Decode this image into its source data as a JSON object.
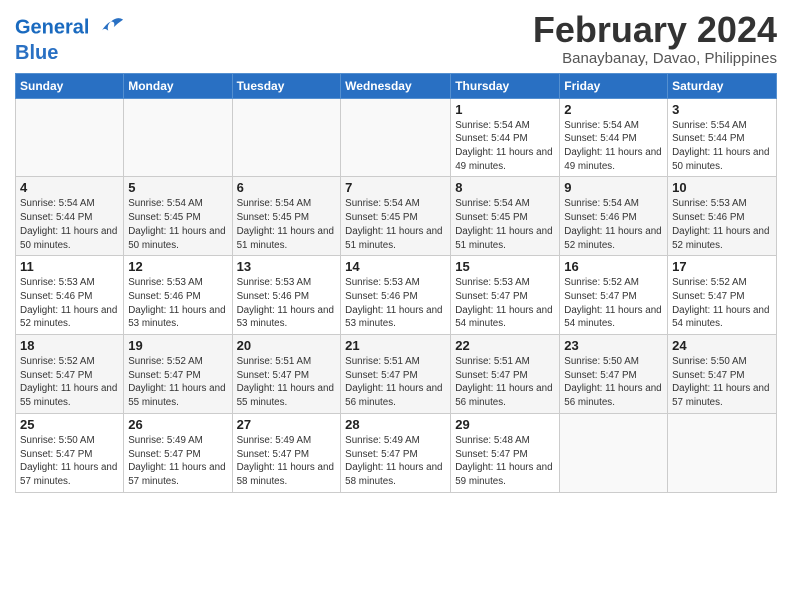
{
  "header": {
    "logo_line1": "General",
    "logo_line2": "Blue",
    "month": "February 2024",
    "location": "Banaybanay, Davao, Philippines"
  },
  "days_of_week": [
    "Sunday",
    "Monday",
    "Tuesday",
    "Wednesday",
    "Thursday",
    "Friday",
    "Saturday"
  ],
  "weeks": [
    [
      {
        "day": "",
        "info": ""
      },
      {
        "day": "",
        "info": ""
      },
      {
        "day": "",
        "info": ""
      },
      {
        "day": "",
        "info": ""
      },
      {
        "day": "1",
        "info": "Sunrise: 5:54 AM\nSunset: 5:44 PM\nDaylight: 11 hours\nand 49 minutes."
      },
      {
        "day": "2",
        "info": "Sunrise: 5:54 AM\nSunset: 5:44 PM\nDaylight: 11 hours\nand 49 minutes."
      },
      {
        "day": "3",
        "info": "Sunrise: 5:54 AM\nSunset: 5:44 PM\nDaylight: 11 hours\nand 50 minutes."
      }
    ],
    [
      {
        "day": "4",
        "info": "Sunrise: 5:54 AM\nSunset: 5:44 PM\nDaylight: 11 hours\nand 50 minutes."
      },
      {
        "day": "5",
        "info": "Sunrise: 5:54 AM\nSunset: 5:45 PM\nDaylight: 11 hours\nand 50 minutes."
      },
      {
        "day": "6",
        "info": "Sunrise: 5:54 AM\nSunset: 5:45 PM\nDaylight: 11 hours\nand 51 minutes."
      },
      {
        "day": "7",
        "info": "Sunrise: 5:54 AM\nSunset: 5:45 PM\nDaylight: 11 hours\nand 51 minutes."
      },
      {
        "day": "8",
        "info": "Sunrise: 5:54 AM\nSunset: 5:45 PM\nDaylight: 11 hours\nand 51 minutes."
      },
      {
        "day": "9",
        "info": "Sunrise: 5:54 AM\nSunset: 5:46 PM\nDaylight: 11 hours\nand 52 minutes."
      },
      {
        "day": "10",
        "info": "Sunrise: 5:53 AM\nSunset: 5:46 PM\nDaylight: 11 hours\nand 52 minutes."
      }
    ],
    [
      {
        "day": "11",
        "info": "Sunrise: 5:53 AM\nSunset: 5:46 PM\nDaylight: 11 hours\nand 52 minutes."
      },
      {
        "day": "12",
        "info": "Sunrise: 5:53 AM\nSunset: 5:46 PM\nDaylight: 11 hours\nand 53 minutes."
      },
      {
        "day": "13",
        "info": "Sunrise: 5:53 AM\nSunset: 5:46 PM\nDaylight: 11 hours\nand 53 minutes."
      },
      {
        "day": "14",
        "info": "Sunrise: 5:53 AM\nSunset: 5:46 PM\nDaylight: 11 hours\nand 53 minutes."
      },
      {
        "day": "15",
        "info": "Sunrise: 5:53 AM\nSunset: 5:47 PM\nDaylight: 11 hours\nand 54 minutes."
      },
      {
        "day": "16",
        "info": "Sunrise: 5:52 AM\nSunset: 5:47 PM\nDaylight: 11 hours\nand 54 minutes."
      },
      {
        "day": "17",
        "info": "Sunrise: 5:52 AM\nSunset: 5:47 PM\nDaylight: 11 hours\nand 54 minutes."
      }
    ],
    [
      {
        "day": "18",
        "info": "Sunrise: 5:52 AM\nSunset: 5:47 PM\nDaylight: 11 hours\nand 55 minutes."
      },
      {
        "day": "19",
        "info": "Sunrise: 5:52 AM\nSunset: 5:47 PM\nDaylight: 11 hours\nand 55 minutes."
      },
      {
        "day": "20",
        "info": "Sunrise: 5:51 AM\nSunset: 5:47 PM\nDaylight: 11 hours\nand 55 minutes."
      },
      {
        "day": "21",
        "info": "Sunrise: 5:51 AM\nSunset: 5:47 PM\nDaylight: 11 hours\nand 56 minutes."
      },
      {
        "day": "22",
        "info": "Sunrise: 5:51 AM\nSunset: 5:47 PM\nDaylight: 11 hours\nand 56 minutes."
      },
      {
        "day": "23",
        "info": "Sunrise: 5:50 AM\nSunset: 5:47 PM\nDaylight: 11 hours\nand 56 minutes."
      },
      {
        "day": "24",
        "info": "Sunrise: 5:50 AM\nSunset: 5:47 PM\nDaylight: 11 hours\nand 57 minutes."
      }
    ],
    [
      {
        "day": "25",
        "info": "Sunrise: 5:50 AM\nSunset: 5:47 PM\nDaylight: 11 hours\nand 57 minutes."
      },
      {
        "day": "26",
        "info": "Sunrise: 5:49 AM\nSunset: 5:47 PM\nDaylight: 11 hours\nand 57 minutes."
      },
      {
        "day": "27",
        "info": "Sunrise: 5:49 AM\nSunset: 5:47 PM\nDaylight: 11 hours\nand 58 minutes."
      },
      {
        "day": "28",
        "info": "Sunrise: 5:49 AM\nSunset: 5:47 PM\nDaylight: 11 hours\nand 58 minutes."
      },
      {
        "day": "29",
        "info": "Sunrise: 5:48 AM\nSunset: 5:47 PM\nDaylight: 11 hours\nand 59 minutes."
      },
      {
        "day": "",
        "info": ""
      },
      {
        "day": "",
        "info": ""
      }
    ]
  ]
}
